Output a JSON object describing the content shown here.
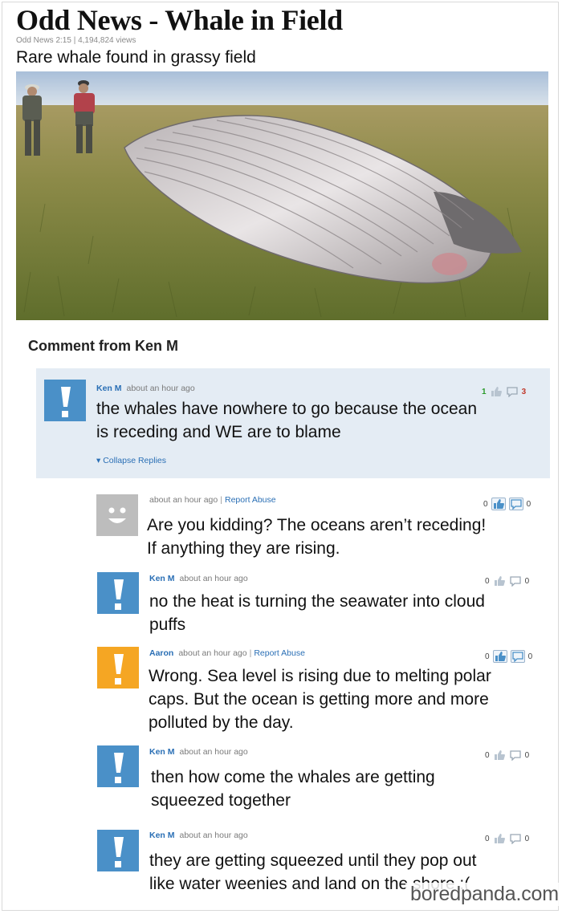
{
  "article": {
    "headline": "Odd News - Whale in Field",
    "byline": "Odd News 2:15 | 4,194,824 views",
    "subtitle": "Rare whale found in grassy field"
  },
  "comments_section": {
    "heading": "Comment from Ken M",
    "collapse_label": "Collapse Replies",
    "main": {
      "author": "Ken M",
      "time": "about an hour ago",
      "text_line1": "the whales have nowhere to go because the ocean",
      "text_line2": "is receding and WE are to blame",
      "up": "1",
      "down": "3"
    },
    "replies": [
      {
        "author": "",
        "time": "about an hour ago",
        "abuse": "Report Abuse",
        "avatar": "smiley-avatar",
        "text_line1": "Are you kidding? The oceans aren’t receding!",
        "text_line2": "If anything they are rising.",
        "text_line3": "",
        "up": "0",
        "down": "0"
      },
      {
        "author": "Ken M",
        "time": "about an hour ago",
        "abuse": "",
        "avatar": "blue-exclamation-avatar",
        "text_line1": "no the heat is turning the seawater into cloud",
        "text_line2": "puffs",
        "text_line3": "",
        "up": "0",
        "down": "0"
      },
      {
        "author": "Aaron",
        "time": "about an hour ago",
        "abuse": "Report Abuse",
        "avatar": "orange-exclamation-avatar",
        "text_line1": "Wrong. Sea level is rising due to melting polar",
        "text_line2": "caps. But the ocean is getting more and more",
        "text_line3": "polluted by the day.",
        "up": "0",
        "down": "0"
      },
      {
        "author": "Ken M",
        "time": "about an hour ago",
        "abuse": "",
        "avatar": "blue-exclamation-avatar",
        "text_line1": "then how come the whales are getting",
        "text_line2": "squeezed together",
        "text_line3": "",
        "up": "0",
        "down": "0"
      },
      {
        "author": "Ken M",
        "time": "about an hour ago",
        "abuse": "",
        "avatar": "blue-exclamation-avatar",
        "text_line1": "they are getting squeezed until they pop out",
        "text_line2": "like water weenies and land on the shore :(",
        "text_line3": "",
        "up": "0",
        "down": "0"
      }
    ]
  },
  "watermark": "boredpanda.com",
  "colors": {
    "link_blue": "#2a6fb5",
    "avatar_blue": "#4a90c8",
    "avatar_orange": "#f5a623",
    "avatar_gray": "#bdbdbd",
    "comment_box": "#e4ecf4"
  }
}
